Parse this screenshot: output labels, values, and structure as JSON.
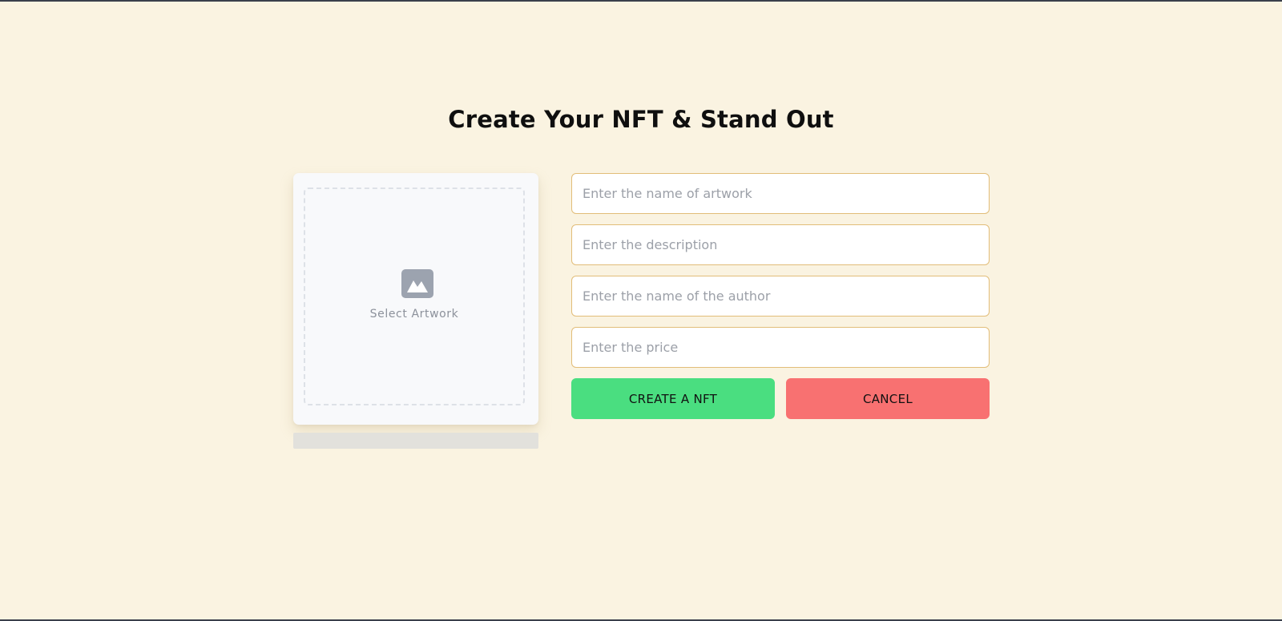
{
  "page": {
    "title": "Create Your NFT & Stand Out"
  },
  "artwork": {
    "select_label": "Select Artwork",
    "icon": "image-icon"
  },
  "form": {
    "fields": [
      {
        "name": "artwork-name",
        "value": "",
        "placeholder": "Enter the name of artwork"
      },
      {
        "name": "description",
        "value": "",
        "placeholder": "Enter the description"
      },
      {
        "name": "author",
        "value": "",
        "placeholder": "Enter the name of the author"
      },
      {
        "name": "price",
        "value": "",
        "placeholder": "Enter the price"
      }
    ],
    "create_label": "CREATE A NFT",
    "cancel_label": "CANCEL"
  },
  "colors": {
    "background": "#faf3e1",
    "field_border": "#e2bd79",
    "create_button": "#4ade80",
    "cancel_button": "#f87171",
    "icon": "#9ca3af"
  }
}
